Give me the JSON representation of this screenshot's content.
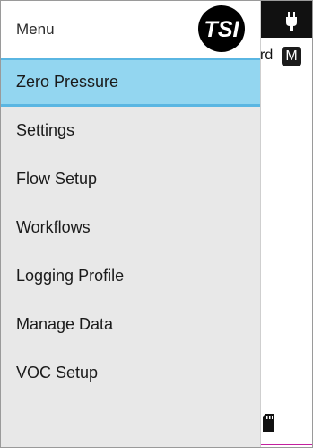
{
  "drawer": {
    "title": "Menu",
    "items": [
      {
        "label": "Zero Pressure",
        "selected": true
      },
      {
        "label": "Settings"
      },
      {
        "label": "Flow Setup"
      },
      {
        "label": "Workflows"
      },
      {
        "label": "Logging Profile"
      },
      {
        "label": "Manage Data"
      },
      {
        "label": "VOC Setup"
      }
    ],
    "logo_icon": "tsi-logo"
  },
  "background_app": {
    "header_text_fragment": "rd",
    "mode_badge": "M",
    "power_icon": "plug-icon",
    "storage_icon": "sd-card-icon"
  },
  "colors": {
    "selected_item": "#93d6f0",
    "selected_border": "#5ab6e2",
    "drawer_bg": "#e8e8e8",
    "topbar_bg": "#111111",
    "accent": "#c3219f"
  }
}
